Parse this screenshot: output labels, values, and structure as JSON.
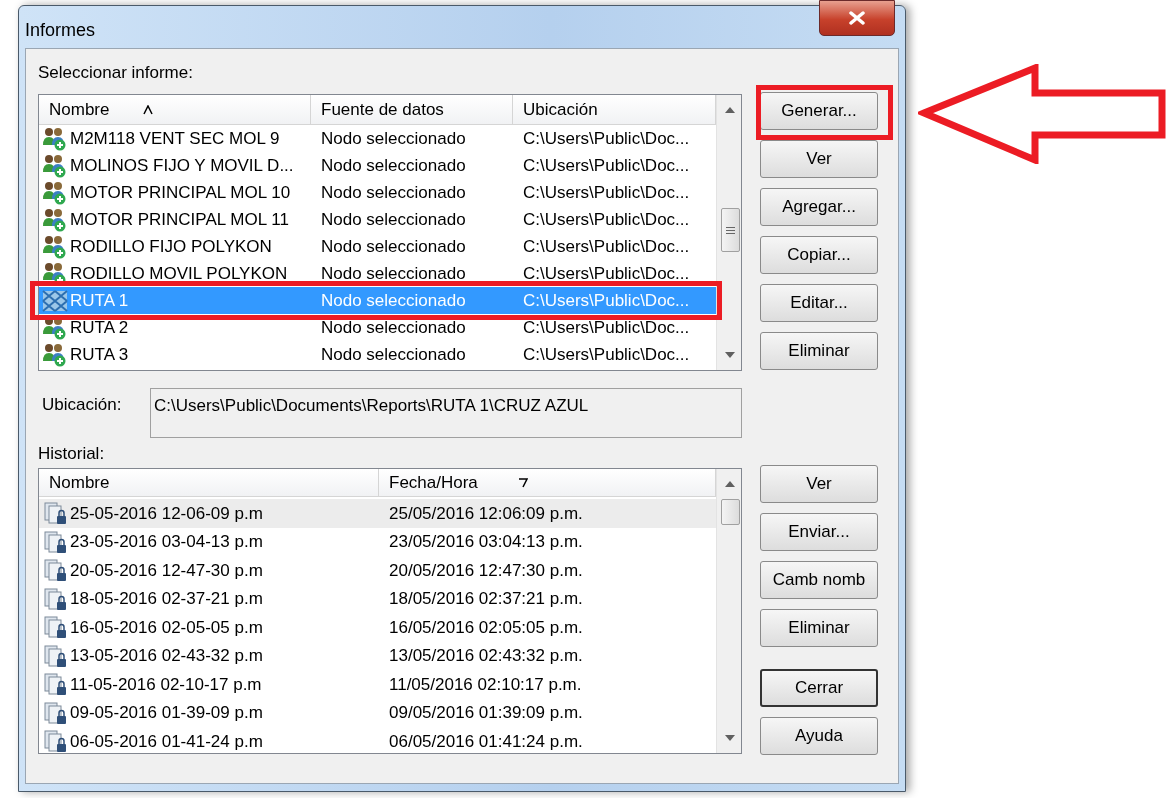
{
  "window": {
    "title": "Informes"
  },
  "reports": {
    "label": "Seleccionar informe:",
    "columns": [
      {
        "label": "Nombre",
        "sorted": true,
        "descending": false
      },
      {
        "label": "Fuente de datos",
        "sorted": false
      },
      {
        "label": "Ubicación",
        "sorted": false
      }
    ],
    "rows": [
      {
        "kind": "group",
        "name": "M2M118 VENT SEC MOL 9",
        "source": "Nodo seleccionado",
        "location": "C:\\Users\\Public\\Doc...",
        "selected": false,
        "highlighted": false
      },
      {
        "kind": "group",
        "name": "MOLINOS FIJO Y MOVIL D...",
        "source": "Nodo seleccionado",
        "location": "C:\\Users\\Public\\Doc...",
        "selected": false,
        "highlighted": false
      },
      {
        "kind": "group",
        "name": "MOTOR PRINCIPAL MOL 10",
        "source": "Nodo seleccionado",
        "location": "C:\\Users\\Public\\Doc...",
        "selected": false,
        "highlighted": false
      },
      {
        "kind": "group",
        "name": "MOTOR PRINCIPAL MOL 11",
        "source": "Nodo seleccionado",
        "location": "C:\\Users\\Public\\Doc...",
        "selected": false,
        "highlighted": false
      },
      {
        "kind": "group",
        "name": "RODILLO FIJO POLYKON",
        "source": "Nodo seleccionado",
        "location": "C:\\Users\\Public\\Doc...",
        "selected": false,
        "highlighted": false
      },
      {
        "kind": "group",
        "name": "RODILLO MOVIL POLYKON",
        "source": "Nodo seleccionado",
        "location": "C:\\Users\\Public\\Doc...",
        "selected": false,
        "highlighted": false
      },
      {
        "kind": "route",
        "name": "RUTA 1",
        "source": "Nodo seleccionado",
        "location": "C:\\Users\\Public\\Doc...",
        "selected": true,
        "highlighted": true
      },
      {
        "kind": "group",
        "name": "RUTA 2",
        "source": "Nodo seleccionado",
        "location": "C:\\Users\\Public\\Doc...",
        "selected": false,
        "highlighted": false
      },
      {
        "kind": "group",
        "name": "RUTA 3",
        "source": "Nodo seleccionado",
        "location": "C:\\Users\\Public\\Doc...",
        "selected": false,
        "highlighted": false
      }
    ]
  },
  "report_buttons": [
    {
      "label": "Generar...",
      "highlighted": true
    },
    {
      "label": "Ver",
      "highlighted": false
    },
    {
      "label": "Agregar...",
      "highlighted": false
    },
    {
      "label": "Copiar...",
      "highlighted": false
    },
    {
      "label": "Editar...",
      "highlighted": false
    },
    {
      "label": "Eliminar",
      "highlighted": false
    }
  ],
  "location": {
    "label": "Ubicación:",
    "value": "C:\\Users\\Public\\Documents\\Reports\\RUTA 1\\CRUZ AZUL"
  },
  "history": {
    "label": "Historial:",
    "columns": [
      {
        "label": "Nombre",
        "sorted": false
      },
      {
        "label": "Fecha/Hora",
        "sorted": true,
        "descending": true
      }
    ],
    "rows": [
      {
        "name": "25-05-2016 12-06-09 p.m",
        "datetime": "25/05/2016 12:06:09 p.m.",
        "selected": true
      },
      {
        "name": "23-05-2016 03-04-13 p.m",
        "datetime": "23/05/2016 03:04:13 p.m.",
        "selected": false
      },
      {
        "name": "20-05-2016 12-47-30 p.m",
        "datetime": "20/05/2016 12:47:30 p.m.",
        "selected": false
      },
      {
        "name": "18-05-2016 02-37-21 p.m",
        "datetime": "18/05/2016 02:37:21 p.m.",
        "selected": false
      },
      {
        "name": "16-05-2016 02-05-05 p.m",
        "datetime": "16/05/2016 02:05:05 p.m.",
        "selected": false
      },
      {
        "name": "13-05-2016 02-43-32 p.m",
        "datetime": "13/05/2016 02:43:32 p.m.",
        "selected": false
      },
      {
        "name": "11-05-2016 02-10-17 p.m",
        "datetime": "11/05/2016 02:10:17 p.m.",
        "selected": false
      },
      {
        "name": "09-05-2016 01-39-09 p.m",
        "datetime": "09/05/2016 01:39:09 p.m.",
        "selected": false
      },
      {
        "name": "06-05-2016 01-41-24 p.m",
        "datetime": "06/05/2016 01:41:24 p.m.",
        "selected": false
      }
    ]
  },
  "history_buttons": [
    {
      "label": "Ver",
      "default": false
    },
    {
      "label": "Enviar...",
      "default": false
    },
    {
      "label": "Camb nomb",
      "default": false
    },
    {
      "label": "Eliminar",
      "default": false
    },
    {
      "label": "Cerrar",
      "default": true
    },
    {
      "label": "Ayuda",
      "default": false
    }
  ]
}
